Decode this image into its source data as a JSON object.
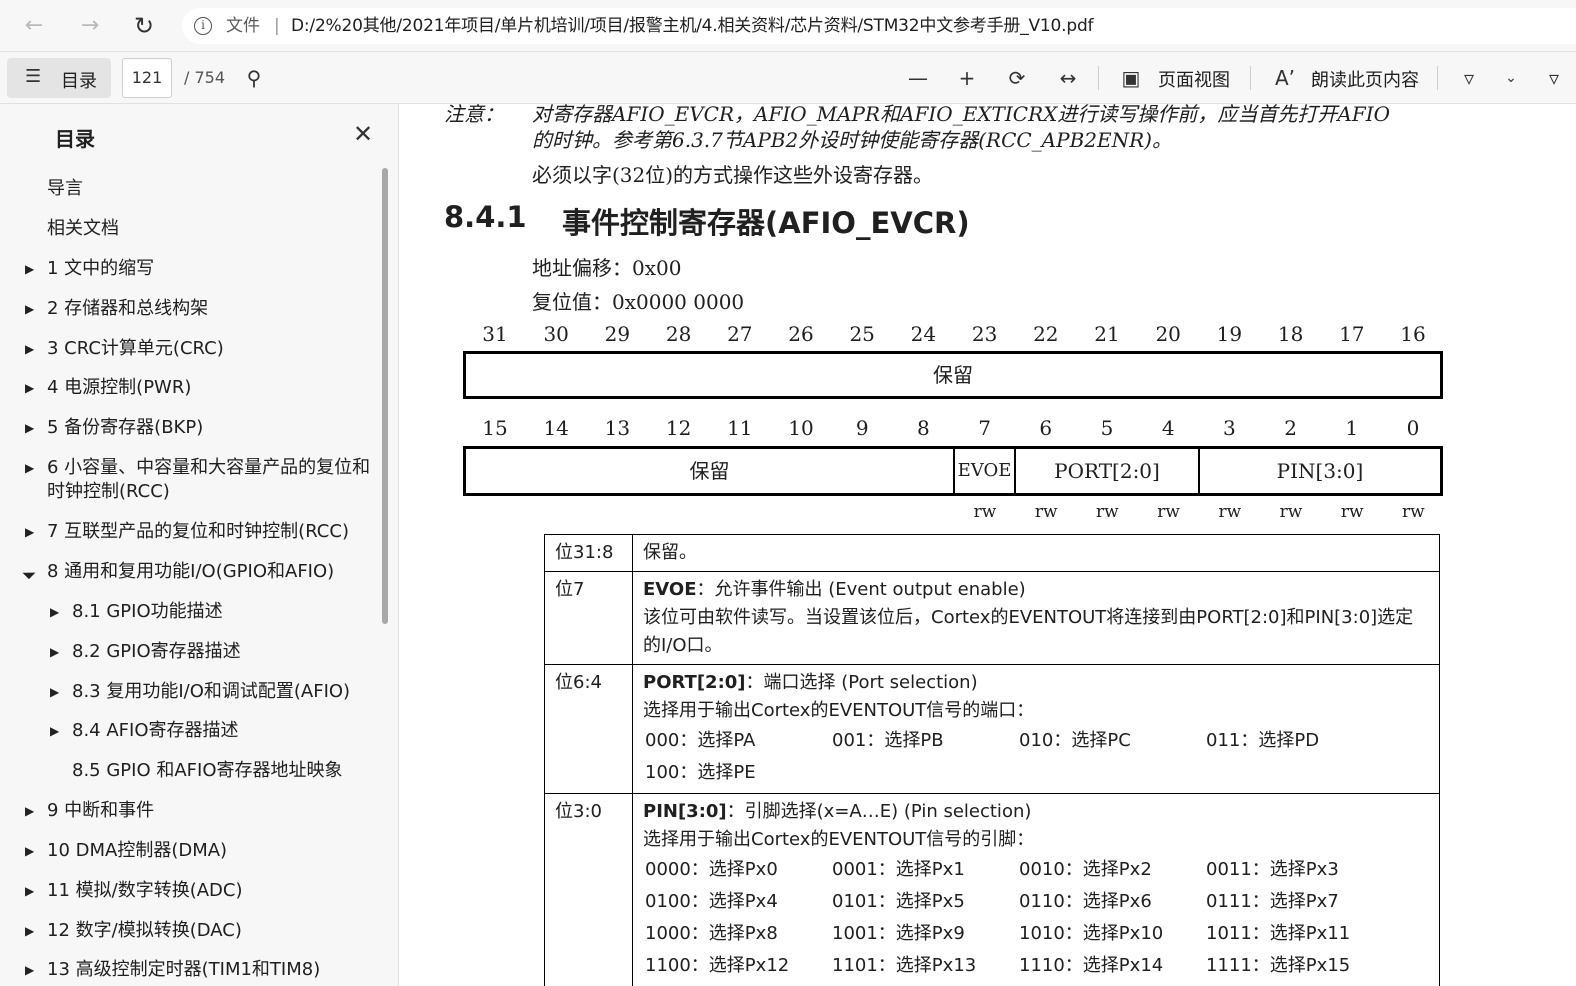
{
  "browser": {
    "file_label": "文件",
    "separator": "|",
    "url": "D:/2%20其他/2021年项目/单片机培训/项目/报警主机/4.相关资料/芯片资料/STM32中文参考手册_V10.pdf"
  },
  "toolbar": {
    "toc_label": "目录",
    "page_current": "121",
    "page_total": "/ 754",
    "page_view_label": "页面视图",
    "read_aloud_label": "朗读此页内容"
  },
  "sidebar": {
    "title": "目录",
    "items": [
      {
        "label": "导言"
      },
      {
        "label": "相关文档"
      },
      {
        "label": "1 文中的缩写"
      },
      {
        "label": "2 存储器和总线构架"
      },
      {
        "label": "3 CRC计算单元(CRC)"
      },
      {
        "label": "4 电源控制(PWR)"
      },
      {
        "label": "5 备份寄存器(BKP)"
      },
      {
        "label": "6 小容量、中容量和大容量产品的复位和"
      },
      {
        "label": "时钟控制(RCC)"
      },
      {
        "label": "7 互联型产品的复位和时钟控制(RCC)"
      },
      {
        "label": "8 通用和复用功能I/O(GPIO和AFIO)"
      },
      {
        "label": "8.1 GPIO功能描述"
      },
      {
        "label": "8.2 GPIO寄存器描述"
      },
      {
        "label": "8.3 复用功能I/O和调试配置(AFIO)"
      },
      {
        "label": "8.4 AFIO寄存器描述"
      },
      {
        "label": "8.5 GPIO 和AFIO寄存器地址映象"
      },
      {
        "label": "9 中断和事件"
      },
      {
        "label": "10 DMA控制器(DMA)"
      },
      {
        "label": "11 模拟/数字转换(ADC)"
      },
      {
        "label": "12 数字/模拟转换(DAC)"
      },
      {
        "label": "13 高级控制定时器(TIM1和TIM8)"
      }
    ]
  },
  "doc": {
    "note_label": "注意：",
    "note_line1": "对寄存器AFIO_EVCR，AFIO_MAPR和AFIO_EXTICRX进行读写操作前，应当首先打开AFIO",
    "note_line2": "的时钟。参考第6.3.7节APB2外设时钟使能寄存器(RCC_APB2ENR)。",
    "note_line3": "必须以字(32位)的方式操作这些外设寄存器。",
    "section_num": "8.4.1",
    "section_title": "事件控制寄存器(AFIO_EVCR)",
    "addr_offset": "地址偏移：0x00",
    "reset_value": "复位值：0x0000 0000",
    "bits_high": [
      "31",
      "30",
      "29",
      "28",
      "27",
      "26",
      "25",
      "24",
      "23",
      "22",
      "21",
      "20",
      "19",
      "18",
      "17",
      "16"
    ],
    "bits_low": [
      "15",
      "14",
      "13",
      "12",
      "11",
      "10",
      "9",
      "8",
      "7",
      "6",
      "5",
      "4",
      "3",
      "2",
      "1",
      "0"
    ],
    "reserved_high": "保留",
    "reserved_low": "保留",
    "field_evoe": "EVOE",
    "field_port": "PORT[2:0]",
    "field_pin": "PIN[3:0]",
    "rw": [
      "rw",
      "rw",
      "rw",
      "rw",
      "rw",
      "rw",
      "rw",
      "rw"
    ],
    "table": {
      "r1_bits": "位31:8",
      "r1_desc": "保留。",
      "r2_bits": "位7",
      "r2_name": "EVOE",
      "r2_title": "：允许事件输出 (Event output enable)",
      "r2_desc": "该位可由软件读写。当设置该位后，Cortex的EVENTOUT将连接到由PORT[2:0]和PIN[3:0]选定的I/O口。",
      "r3_bits": "位6:4",
      "r3_name": "PORT[2:0]",
      "r3_title": "：端口选择 (Port selection)",
      "r3_desc": "选择用于输出Cortex的EVENTOUT信号的端口：",
      "r3_opts": [
        "000：选择PA",
        "001：选择PB",
        "010：选择PC",
        "011：选择PD",
        "100：选择PE"
      ],
      "r4_bits": "位3:0",
      "r4_name": "PIN[3:0]",
      "r4_title": "：引脚选择(x=A…E) (Pin selection)",
      "r4_desc": "选择用于输出Cortex的EVENTOUT信号的引脚：",
      "r4_opts": [
        "0000：选择Px0",
        "0001：选择Px1",
        "0010：选择Px2",
        "0011：选择Px3",
        "0100：选择Px4",
        "0101：选择Px5",
        "0110：选择Px6",
        "0111：选择Px7",
        "1000：选择Px8",
        "1001：选择Px9",
        "1010：选择Px10",
        "1011：选择Px11",
        "1100：选择Px12",
        "1101：选择Px13",
        "1110：选择Px14",
        "1111：选择Px15"
      ]
    }
  }
}
